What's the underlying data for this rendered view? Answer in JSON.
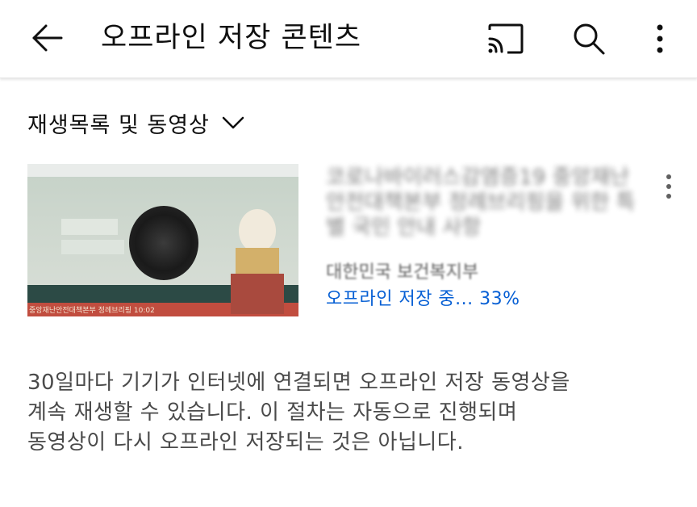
{
  "header": {
    "title": "오프라인 저장 콘텐츠",
    "back_icon": "arrow-left-icon",
    "cast_icon": "cast-icon",
    "search_icon": "search-icon",
    "more_icon": "more-vertical-icon"
  },
  "filter": {
    "label": "재생목록 및 동영상",
    "icon": "chevron-down-icon"
  },
  "videos": [
    {
      "title": "코로나바이러스감염증19 중앙재난안전대책본부 정례브리핑을 위한 특별 국민 안내 사항",
      "channel": "대한민국 보건복지부",
      "status": "오프라인 저장 중... 33%",
      "progress": 0.33,
      "thumbnail_caption": "중앙재난안전대책본부 정례브리핑 10:02",
      "more_icon": "more-vertical-icon"
    }
  ],
  "info": {
    "lines": [
      "30일마다 기기가 인터넷에 연결되면 오프라인 저장 동영상을",
      "계속 재생할 수 있습니다. 이 절차는 자동으로 진행되며",
      "동영상이 다시 오프라인 저장되는 것은 아닙니다."
    ]
  },
  "colors": {
    "accent": "#065fd4",
    "text_primary": "#0f0f0f",
    "text_secondary": "#606060",
    "background": "#ffffff"
  }
}
